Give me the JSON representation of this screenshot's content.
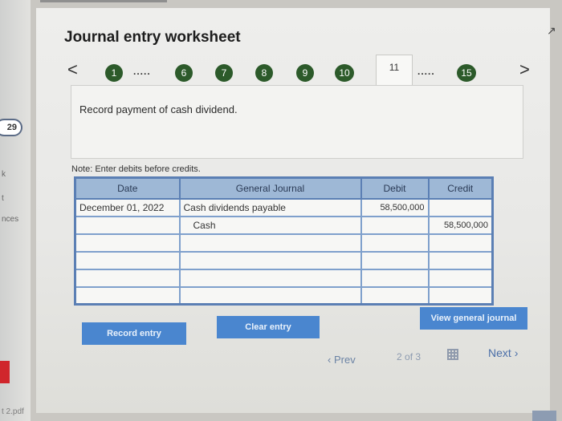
{
  "background_window": {
    "badge": "29",
    "fragments": [
      "k",
      "t",
      "nces"
    ],
    "file_label": "t 2.pdf"
  },
  "worksheet": {
    "title": "Journal entry worksheet",
    "steps": [
      "1",
      "6",
      "7",
      "8",
      "9",
      "10",
      "11",
      "15"
    ],
    "current_step": "11",
    "dots": ".....",
    "prev_arrow": "<",
    "next_arrow": ">",
    "instruction": "Record payment of cash dividend.",
    "note": "Note: Enter debits before credits."
  },
  "journal": {
    "headers": {
      "date": "Date",
      "general_journal": "General Journal",
      "debit": "Debit",
      "credit": "Credit"
    },
    "rows": [
      {
        "date": "December 01, 2022",
        "account": "Cash dividends payable",
        "debit": "58,500,000",
        "credit": ""
      },
      {
        "date": "",
        "account": "Cash",
        "debit": "",
        "credit": "58,500,000"
      },
      {
        "date": "",
        "account": "",
        "debit": "",
        "credit": ""
      },
      {
        "date": "",
        "account": "",
        "debit": "",
        "credit": ""
      },
      {
        "date": "",
        "account": "",
        "debit": "",
        "credit": ""
      },
      {
        "date": "",
        "account": "",
        "debit": "",
        "credit": ""
      }
    ]
  },
  "buttons": {
    "record": "Record entry",
    "clear": "Clear entry",
    "view": "View general journal"
  },
  "pager": {
    "prev": "Prev",
    "position": "2",
    "of": "of",
    "total": "3",
    "next": "Next"
  },
  "colors": {
    "step_green": "#2c5a2a",
    "table_header": "#9eb8d6",
    "table_border": "#5b7fb4",
    "button_blue": "#4a86cf"
  }
}
